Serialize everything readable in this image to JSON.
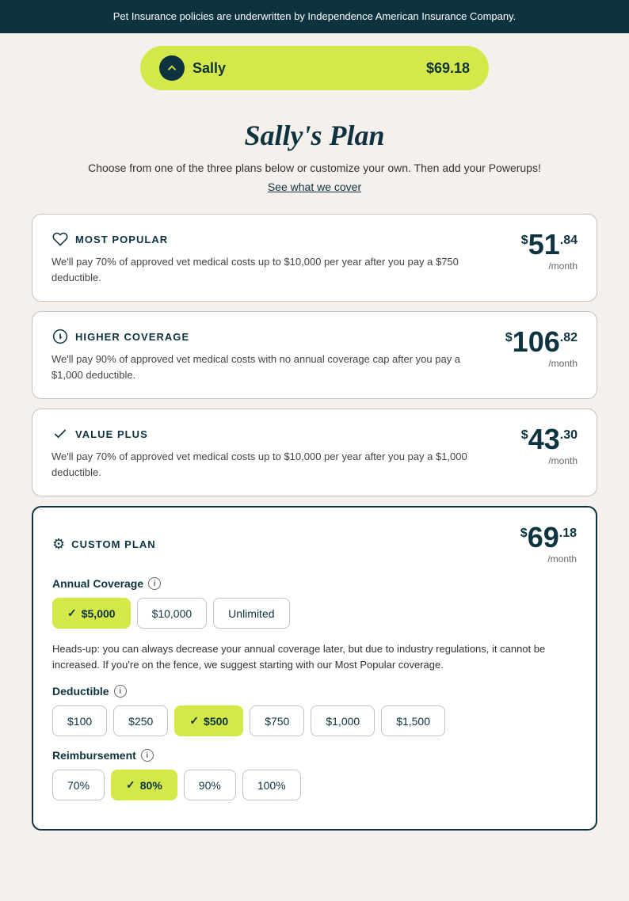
{
  "topBar": {
    "text": "Pet Insurance policies are underwritten by Independence American Insurance Company."
  },
  "banner": {
    "petName": "Sally",
    "price": "$69.18",
    "iconLabel": "↑"
  },
  "header": {
    "title": "Sally's Plan",
    "subtitle": "Choose from one of the three plans below or customize your own. Then add your Powerups!",
    "seeWhatLink": "See what we cover"
  },
  "plans": [
    {
      "id": "most-popular",
      "iconSymbol": "♡",
      "label": "MOST POPULAR",
      "description": "We'll pay 70% of approved vet medical costs up to $10,000 per year after you pay a $750 deductible.",
      "priceDollar": "$",
      "priceMain": "51",
      "priceCents": ".84",
      "priceMonth": "/month"
    },
    {
      "id": "higher-coverage",
      "iconSymbol": "⬆",
      "label": "HIGHER COVERAGE",
      "description": "We'll pay 90% of approved vet medical costs with no annual coverage cap after you pay a $1,000 deductible.",
      "priceDollar": "$",
      "priceMain": "106",
      "priceCents": ".82",
      "priceMonth": "/month"
    },
    {
      "id": "value-plus",
      "iconSymbol": "✓",
      "label": "VALUE PLUS",
      "description": "We'll pay 70% of approved vet medical costs up to $10,000 per year after you pay a $1,000 deductible.",
      "priceDollar": "$",
      "priceMain": "43",
      "priceCents": ".30",
      "priceMonth": "/month"
    }
  ],
  "customPlan": {
    "label": "CUSTOM PLAN",
    "priceDollar": "$",
    "priceMain": "69",
    "priceCents": ".18",
    "priceMonth": "/month",
    "annualCoverage": {
      "sectionTitle": "Annual Coverage",
      "options": [
        {
          "label": "$5,000",
          "selected": true
        },
        {
          "label": "$10,000",
          "selected": false
        },
        {
          "label": "Unlimited",
          "selected": false
        }
      ],
      "headsUp": "Heads-up: you can always decrease your annual coverage later, but due to industry regulations, it cannot be increased. If you're on the fence, we suggest starting with our Most Popular coverage."
    },
    "deductible": {
      "sectionTitle": "Deductible",
      "options": [
        {
          "label": "$100",
          "selected": false
        },
        {
          "label": "$250",
          "selected": false
        },
        {
          "label": "$500",
          "selected": true
        },
        {
          "label": "$750",
          "selected": false
        },
        {
          "label": "$1,000",
          "selected": false
        },
        {
          "label": "$1,500",
          "selected": false
        }
      ]
    },
    "reimbursement": {
      "sectionTitle": "Reimbursement",
      "options": [
        {
          "label": "70%",
          "selected": false
        },
        {
          "label": "80%",
          "selected": true
        },
        {
          "label": "90%",
          "selected": false
        },
        {
          "label": "100%",
          "selected": false
        }
      ]
    }
  }
}
